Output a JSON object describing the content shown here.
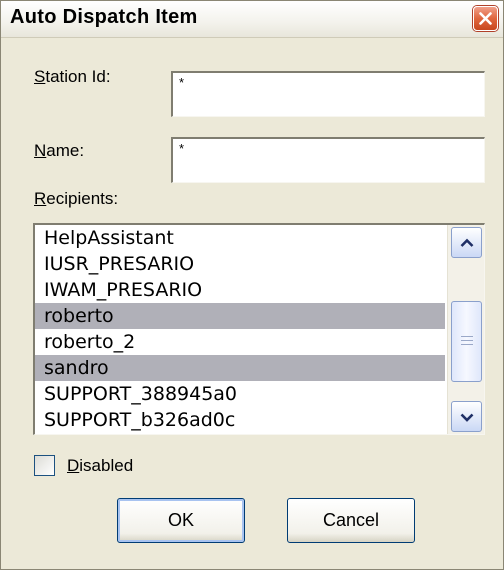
{
  "dialog": {
    "title": "Auto Dispatch Item"
  },
  "station": {
    "label_mnemonic": "S",
    "label_rest": "tation Id:",
    "value": "*"
  },
  "name": {
    "label_mnemonic": "N",
    "label_rest": "ame:",
    "value": "*"
  },
  "recipients": {
    "label_mnemonic": "R",
    "label_rest": "ecipients:",
    "items": [
      {
        "label": "HelpAssistant",
        "selected": false
      },
      {
        "label": "IUSR_PRESARIO",
        "selected": false
      },
      {
        "label": "IWAM_PRESARIO",
        "selected": false
      },
      {
        "label": "roberto",
        "selected": true
      },
      {
        "label": "roberto_2",
        "selected": false
      },
      {
        "label": "sandro",
        "selected": true
      },
      {
        "label": "SUPPORT_388945a0",
        "selected": false
      },
      {
        "label": "SUPPORT_b326ad0c",
        "selected": false
      }
    ]
  },
  "disabled": {
    "label_mnemonic": "D",
    "label_rest": "isabled",
    "checked": false
  },
  "buttons": {
    "ok": "OK",
    "cancel": "Cancel"
  },
  "icons": {
    "close": "close-icon",
    "scroll_up": "chevron-up-icon",
    "scroll_down": "chevron-down-icon"
  },
  "colors": {
    "dialog_bg": "#ece9d8",
    "selection": "#b0b0b8",
    "close_button": "#e0663e"
  }
}
